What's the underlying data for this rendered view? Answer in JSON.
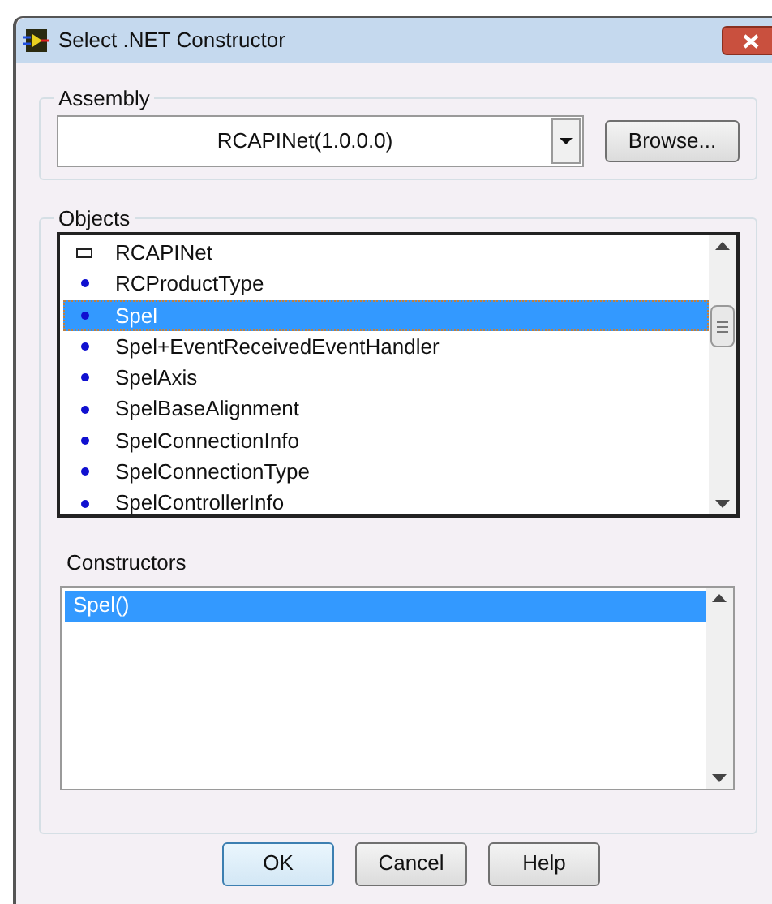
{
  "window": {
    "title": "Select .NET Constructor"
  },
  "assembly": {
    "label": "Assembly",
    "value": "RCAPINet(1.0.0.0)",
    "browse_button": "Browse..."
  },
  "objects": {
    "label": "Objects",
    "items": [
      {
        "name": "RCAPINet",
        "kind": "namespace",
        "selected": false
      },
      {
        "name": "RCProductType",
        "kind": "class",
        "selected": false
      },
      {
        "name": "Spel",
        "kind": "class",
        "selected": true
      },
      {
        "name": "Spel+EventReceivedEventHandler",
        "kind": "class",
        "selected": false
      },
      {
        "name": "SpelAxis",
        "kind": "class",
        "selected": false
      },
      {
        "name": "SpelBaseAlignment",
        "kind": "class",
        "selected": false
      },
      {
        "name": "SpelConnectionInfo",
        "kind": "class",
        "selected": false
      },
      {
        "name": "SpelConnectionType",
        "kind": "class",
        "selected": false
      },
      {
        "name": "SpelControllerInfo",
        "kind": "class",
        "selected": false
      }
    ]
  },
  "constructors": {
    "label": "Constructors",
    "items": [
      {
        "name": "Spel()",
        "selected": true
      }
    ]
  },
  "buttons": [
    {
      "label": "OK",
      "default": true
    },
    {
      "label": "Cancel",
      "default": false
    },
    {
      "label": "Help",
      "default": false
    }
  ]
}
